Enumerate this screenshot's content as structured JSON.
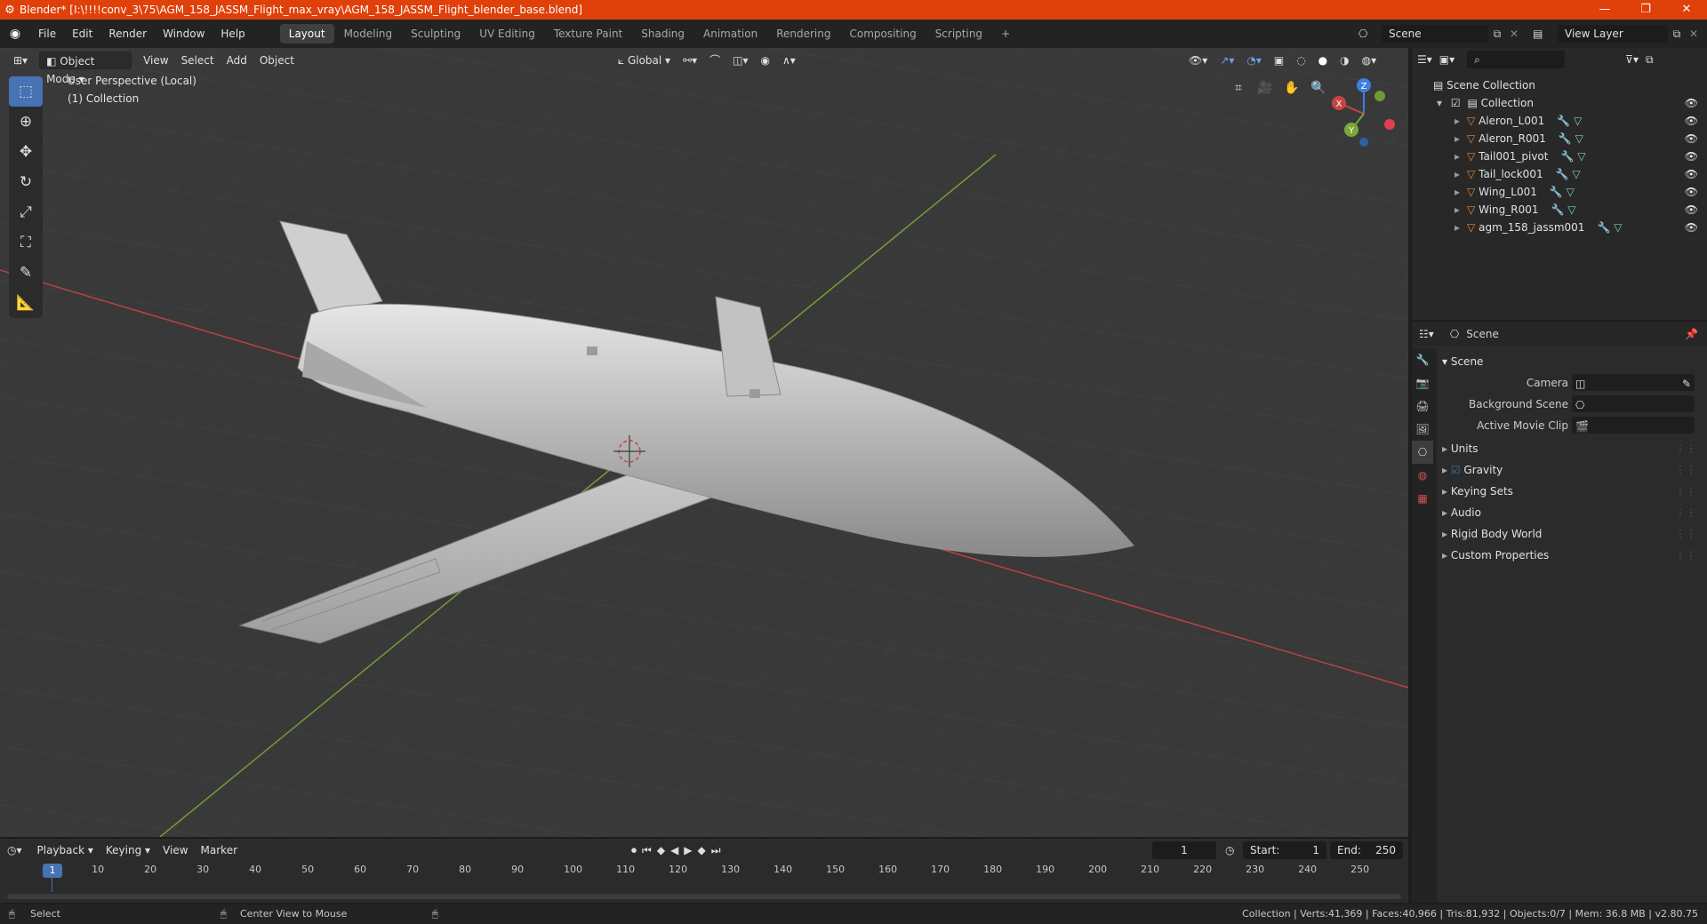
{
  "window": {
    "title": "Blender* [I:\\!!!!conv_3\\75\\AGM_158_JASSM_Flight_max_vray\\AGM_158_JASSM_Flight_blender_base.blend]",
    "controls": [
      "—",
      "❐",
      "✕"
    ]
  },
  "menubar": {
    "menus": [
      "File",
      "Edit",
      "Render",
      "Window",
      "Help"
    ],
    "workspaces": [
      "Layout",
      "Modeling",
      "Sculpting",
      "UV Editing",
      "Texture Paint",
      "Shading",
      "Animation",
      "Rendering",
      "Compositing",
      "Scripting"
    ],
    "active_workspace": "Layout",
    "add_tab": "+",
    "scene": "Scene",
    "view_layer": "View Layer"
  },
  "viewport": {
    "mode": "Object Mode",
    "menus": [
      "View",
      "Select",
      "Add",
      "Object"
    ],
    "transform_orientation": "Global",
    "perspective_label": "User Perspective (Local)",
    "collection_label": "(1) Collection",
    "gizmo": {
      "x": "X",
      "y": "Y",
      "z": "Z"
    },
    "colors": {
      "x_axis": "#c84444",
      "y_axis": "#7aa834",
      "z_axis": "#3f7ee0",
      "background": "#393939"
    }
  },
  "outliner": {
    "root": "Scene Collection",
    "collection": "Collection",
    "objects": [
      "Aleron_L001",
      "Aleron_R001",
      "Tail001_pivot",
      "Tail_lock001",
      "Wing_L001",
      "Wing_R001",
      "agm_158_jassm001"
    ]
  },
  "properties": {
    "context": "Scene",
    "panel_title": "Scene",
    "fields": [
      {
        "label": "Camera"
      },
      {
        "label": "Background Scene"
      },
      {
        "label": "Active Movie Clip"
      }
    ],
    "sections": [
      "Units",
      "Gravity",
      "Keying Sets",
      "Audio",
      "Rigid Body World",
      "Custom Properties"
    ],
    "gravity_checked": true
  },
  "timeline": {
    "menus": [
      "Playback",
      "Keying",
      "View",
      "Marker"
    ],
    "current_frame": "1",
    "start_label": "Start:",
    "start": "1",
    "end_label": "End:",
    "end": "250",
    "ticks": [
      "10",
      "20",
      "30",
      "40",
      "50",
      "60",
      "70",
      "80",
      "90",
      "100",
      "110",
      "120",
      "130",
      "140",
      "150",
      "160",
      "170",
      "180",
      "190",
      "200",
      "210",
      "220",
      "230",
      "240",
      "250"
    ],
    "cursor_frame": "1"
  },
  "statusbar": {
    "left_action": "Select",
    "middle_action": "Center View to Mouse",
    "stats": "Collection | Verts:41,369 | Faces:40,966 | Tris:81,932 | Objects:0/7 | Mem: 36.8 MB | v2.80.75"
  }
}
